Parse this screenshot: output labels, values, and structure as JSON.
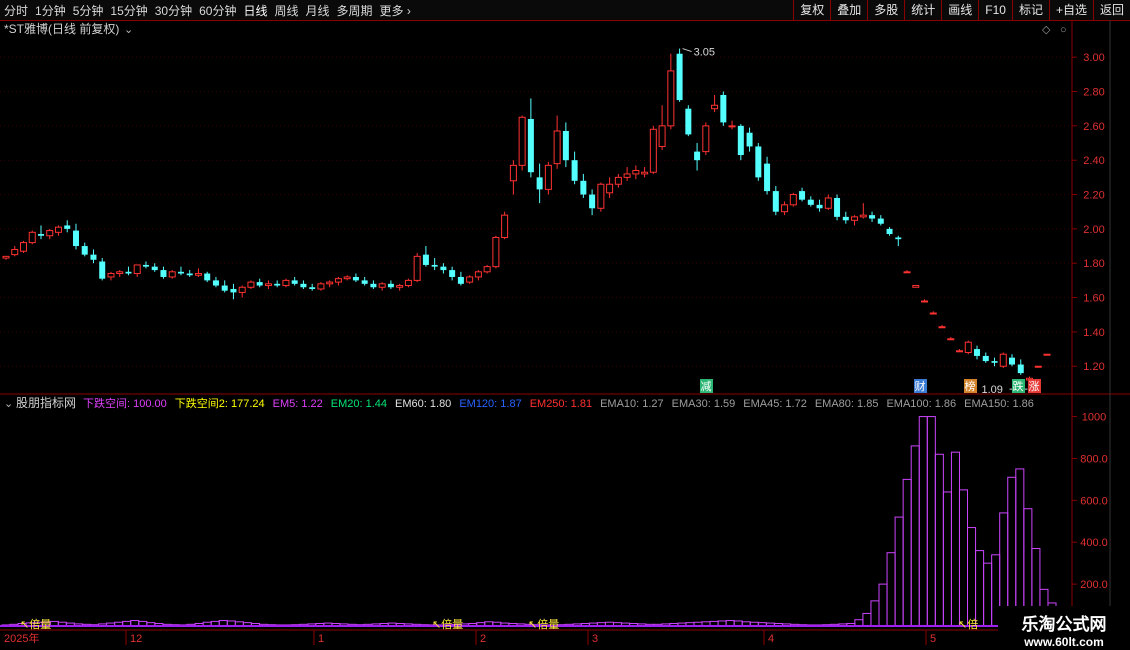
{
  "toolbar": {
    "periods": [
      "分时",
      "1分钟",
      "5分钟",
      "15分钟",
      "30分钟",
      "60分钟",
      "日线",
      "周线",
      "月线",
      "多周期",
      "更多"
    ],
    "active": "日线",
    "right_buttons": [
      "复权",
      "叠加",
      "多股",
      "统计",
      "画线",
      "F10",
      "标记",
      "+自选",
      "返回"
    ]
  },
  "price_panel": {
    "title": "*ST雅博(日线 前复权)",
    "y_ticks": [
      "3.00",
      "2.80",
      "2.60",
      "2.40",
      "2.20",
      "2.00",
      "1.80",
      "1.60",
      "1.40",
      "1.20"
    ],
    "high_label": "3.05",
    "low_label": "1.09",
    "event_markers": [
      {
        "text": "减",
        "color": "#2bb673"
      },
      {
        "text": "财",
        "color": "#3a7bd5"
      },
      {
        "text": "榜",
        "color": "#d4822a"
      },
      {
        "text": "跌",
        "color": "#2bb673"
      },
      {
        "text": "涨",
        "color": "#e53935"
      }
    ]
  },
  "indicator_panel": {
    "name": "股朋指标网",
    "legend": [
      {
        "text": "下跌空间: 100.00",
        "color": "#e040fb"
      },
      {
        "text": "下跌空间2: 177.24",
        "color": "#ffff00"
      },
      {
        "text": "EM5: 1.22",
        "color": "#e040fb"
      },
      {
        "text": "EM20: 1.44",
        "color": "#00e676"
      },
      {
        "text": "EM60: 1.80",
        "color": "#e0e0e0"
      },
      {
        "text": "EM120: 1.87",
        "color": "#2962ff"
      },
      {
        "text": "EM250: 1.81",
        "color": "#ff3030"
      },
      {
        "text": "EMA10: 1.27",
        "color": "#9e9e9e"
      },
      {
        "text": "EMA30: 1.59",
        "color": "#9e9e9e"
      },
      {
        "text": "EMA45: 1.72",
        "color": "#9e9e9e"
      },
      {
        "text": "EMA80: 1.85",
        "color": "#9e9e9e"
      },
      {
        "text": "EMA100: 1.86",
        "color": "#9e9e9e"
      },
      {
        "text": "EMA150: 1.86",
        "color": "#9e9e9e"
      }
    ],
    "y_ticks": [
      "1000",
      "800.0",
      "600.0",
      "400.0",
      "200.0"
    ],
    "tags": [
      "倍量",
      "倍量",
      "倍量",
      "倍"
    ]
  },
  "x_axis": {
    "labels": [
      "2025年",
      "12",
      "1",
      "2",
      "3",
      "4",
      "5"
    ]
  },
  "watermark": {
    "line1": "乐淘公式网",
    "line2": "www.60lt.com"
  },
  "colors": {
    "up": "#ff3232",
    "down": "#54ffff",
    "axis": "#8b0000",
    "indicator": "#cc44ff"
  },
  "chart_data": {
    "type": "candlestick",
    "price_ylim": [
      1.05,
      3.1
    ],
    "indicator_ylim": [
      0,
      1060
    ],
    "candles": [
      [
        1.83,
        1.84,
        1.82,
        1.84
      ],
      [
        1.85,
        1.9,
        1.84,
        1.88
      ],
      [
        1.87,
        1.93,
        1.86,
        1.92
      ],
      [
        1.92,
        1.99,
        1.91,
        1.98
      ],
      [
        1.97,
        2.02,
        1.94,
        1.96
      ],
      [
        1.96,
        2.0,
        1.94,
        1.99
      ],
      [
        1.98,
        2.02,
        1.96,
        2.01
      ],
      [
        2.02,
        2.05,
        1.98,
        2.0
      ],
      [
        1.99,
        2.03,
        1.88,
        1.9
      ],
      [
        1.9,
        1.92,
        1.84,
        1.85
      ],
      [
        1.85,
        1.88,
        1.8,
        1.82
      ],
      [
        1.81,
        1.83,
        1.7,
        1.71
      ],
      [
        1.72,
        1.75,
        1.7,
        1.74
      ],
      [
        1.74,
        1.76,
        1.72,
        1.75
      ],
      [
        1.75,
        1.78,
        1.73,
        1.74
      ],
      [
        1.74,
        1.79,
        1.72,
        1.79
      ],
      [
        1.79,
        1.81,
        1.77,
        1.78
      ],
      [
        1.78,
        1.8,
        1.75,
        1.76
      ],
      [
        1.76,
        1.78,
        1.71,
        1.72
      ],
      [
        1.72,
        1.76,
        1.71,
        1.75
      ],
      [
        1.75,
        1.78,
        1.73,
        1.74
      ],
      [
        1.74,
        1.76,
        1.72,
        1.73
      ],
      [
        1.73,
        1.77,
        1.72,
        1.74
      ],
      [
        1.74,
        1.75,
        1.69,
        1.7
      ],
      [
        1.7,
        1.72,
        1.66,
        1.67
      ],
      [
        1.67,
        1.7,
        1.63,
        1.64
      ],
      [
        1.65,
        1.68,
        1.59,
        1.63
      ],
      [
        1.63,
        1.67,
        1.6,
        1.66
      ],
      [
        1.66,
        1.7,
        1.65,
        1.69
      ],
      [
        1.69,
        1.71,
        1.66,
        1.67
      ],
      [
        1.67,
        1.7,
        1.65,
        1.68
      ],
      [
        1.68,
        1.7,
        1.66,
        1.67
      ],
      [
        1.67,
        1.71,
        1.66,
        1.7
      ],
      [
        1.7,
        1.72,
        1.67,
        1.68
      ],
      [
        1.68,
        1.7,
        1.65,
        1.66
      ],
      [
        1.66,
        1.68,
        1.64,
        1.65
      ],
      [
        1.65,
        1.69,
        1.64,
        1.68
      ],
      [
        1.68,
        1.7,
        1.66,
        1.69
      ],
      [
        1.69,
        1.72,
        1.67,
        1.71
      ],
      [
        1.71,
        1.73,
        1.7,
        1.72
      ],
      [
        1.72,
        1.74,
        1.69,
        1.7
      ],
      [
        1.7,
        1.72,
        1.67,
        1.68
      ],
      [
        1.68,
        1.7,
        1.65,
        1.66
      ],
      [
        1.66,
        1.69,
        1.64,
        1.68
      ],
      [
        1.68,
        1.7,
        1.65,
        1.66
      ],
      [
        1.66,
        1.68,
        1.64,
        1.67
      ],
      [
        1.67,
        1.71,
        1.66,
        1.7
      ],
      [
        1.7,
        1.86,
        1.69,
        1.84
      ],
      [
        1.85,
        1.9,
        1.78,
        1.79
      ],
      [
        1.79,
        1.83,
        1.76,
        1.78
      ],
      [
        1.78,
        1.8,
        1.74,
        1.76
      ],
      [
        1.76,
        1.78,
        1.7,
        1.72
      ],
      [
        1.72,
        1.75,
        1.67,
        1.68
      ],
      [
        1.69,
        1.73,
        1.68,
        1.72
      ],
      [
        1.72,
        1.76,
        1.7,
        1.75
      ],
      [
        1.75,
        1.79,
        1.74,
        1.78
      ],
      [
        1.78,
        1.96,
        1.77,
        1.95
      ],
      [
        1.95,
        2.1,
        1.94,
        2.08
      ],
      [
        2.28,
        2.4,
        2.2,
        2.37
      ],
      [
        2.37,
        2.66,
        2.34,
        2.65
      ],
      [
        2.64,
        2.76,
        2.3,
        2.33
      ],
      [
        2.3,
        2.38,
        2.15,
        2.23
      ],
      [
        2.23,
        2.39,
        2.2,
        2.37
      ],
      [
        2.38,
        2.66,
        2.35,
        2.57
      ],
      [
        2.57,
        2.62,
        2.36,
        2.4
      ],
      [
        2.4,
        2.45,
        2.26,
        2.28
      ],
      [
        2.28,
        2.32,
        2.18,
        2.2
      ],
      [
        2.2,
        2.23,
        2.08,
        2.12
      ],
      [
        2.12,
        2.27,
        2.1,
        2.26
      ],
      [
        2.21,
        2.3,
        2.18,
        2.26
      ],
      [
        2.26,
        2.32,
        2.24,
        2.3
      ],
      [
        2.3,
        2.36,
        2.28,
        2.32
      ],
      [
        2.32,
        2.37,
        2.29,
        2.34
      ],
      [
        2.32,
        2.36,
        2.3,
        2.33
      ],
      [
        2.33,
        2.6,
        2.32,
        2.58
      ],
      [
        2.48,
        2.72,
        2.46,
        2.6
      ],
      [
        2.6,
        3.02,
        2.58,
        2.92
      ],
      [
        3.02,
        3.05,
        2.74,
        2.75
      ],
      [
        2.7,
        2.72,
        2.54,
        2.55
      ],
      [
        2.45,
        2.5,
        2.34,
        2.4
      ],
      [
        2.45,
        2.62,
        2.43,
        2.6
      ],
      [
        2.7,
        2.78,
        2.68,
        2.72
      ],
      [
        2.78,
        2.8,
        2.6,
        2.62
      ],
      [
        2.6,
        2.63,
        2.58,
        2.6
      ],
      [
        2.6,
        2.61,
        2.4,
        2.43
      ],
      [
        2.56,
        2.59,
        2.45,
        2.48
      ],
      [
        2.48,
        2.5,
        2.28,
        2.3
      ],
      [
        2.38,
        2.42,
        2.2,
        2.22
      ],
      [
        2.22,
        2.25,
        2.08,
        2.1
      ],
      [
        2.1,
        2.16,
        2.08,
        2.14
      ],
      [
        2.14,
        2.21,
        2.13,
        2.2
      ],
      [
        2.22,
        2.24,
        2.16,
        2.17
      ],
      [
        2.17,
        2.19,
        2.13,
        2.14
      ],
      [
        2.14,
        2.17,
        2.1,
        2.12
      ],
      [
        2.12,
        2.2,
        2.11,
        2.18
      ],
      [
        2.18,
        2.2,
        2.05,
        2.07
      ],
      [
        2.07,
        2.1,
        2.03,
        2.05
      ],
      [
        2.05,
        2.08,
        2.02,
        2.07
      ],
      [
        2.07,
        2.15,
        2.06,
        2.08
      ],
      [
        2.08,
        2.1,
        2.04,
        2.06
      ],
      [
        2.06,
        2.08,
        2.02,
        2.03
      ],
      [
        2.0,
        2.01,
        1.96,
        1.97
      ],
      [
        1.95,
        1.96,
        1.9,
        1.94
      ],
      [
        1.75,
        1.76,
        1.75,
        1.75
      ],
      [
        1.66,
        1.67,
        1.66,
        1.67
      ],
      [
        1.58,
        1.59,
        1.58,
        1.58
      ],
      [
        1.51,
        1.52,
        1.51,
        1.51
      ],
      [
        1.43,
        1.44,
        1.43,
        1.43
      ],
      [
        1.36,
        1.37,
        1.36,
        1.36
      ],
      [
        1.29,
        1.3,
        1.29,
        1.29
      ],
      [
        1.28,
        1.35,
        1.27,
        1.34
      ],
      [
        1.3,
        1.32,
        1.24,
        1.26
      ],
      [
        1.26,
        1.28,
        1.22,
        1.23
      ],
      [
        1.23,
        1.25,
        1.2,
        1.22
      ],
      [
        1.2,
        1.28,
        1.19,
        1.27
      ],
      [
        1.25,
        1.27,
        1.2,
        1.21
      ],
      [
        1.21,
        1.24,
        1.15,
        1.16
      ],
      [
        1.12,
        1.14,
        1.09,
        1.13
      ],
      [
        1.2,
        1.2,
        1.2,
        1.2
      ],
      [
        1.27,
        1.27,
        1.27,
        1.27
      ]
    ],
    "indicator_values": [
      5,
      8,
      12,
      15,
      18,
      20,
      22,
      18,
      14,
      10,
      8,
      6,
      10,
      14,
      18,
      22,
      26,
      22,
      16,
      12,
      8,
      6,
      5,
      8,
      12,
      18,
      22,
      26,
      24,
      20,
      16,
      12,
      8,
      6,
      5,
      5,
      6,
      8,
      10,
      12,
      14,
      12,
      10,
      8,
      6,
      8,
      10,
      12,
      14,
      12,
      10,
      8,
      6,
      5,
      5,
      6,
      8,
      10,
      12,
      16,
      20,
      18,
      14,
      12,
      10,
      8,
      6,
      5,
      5,
      6,
      8,
      10,
      12,
      14,
      16,
      18,
      16,
      14,
      12,
      10,
      8,
      8,
      10,
      12,
      14,
      16,
      18,
      20,
      22,
      24,
      26,
      24,
      20,
      18,
      16,
      14,
      12,
      10,
      8,
      6,
      5,
      5,
      6,
      8,
      10,
      12,
      30,
      60,
      120,
      200,
      350,
      520,
      700,
      860,
      1000,
      1000,
      820,
      640,
      830,
      650,
      470,
      360,
      300,
      340,
      540,
      710,
      750,
      560,
      370,
      175,
      110
    ]
  }
}
